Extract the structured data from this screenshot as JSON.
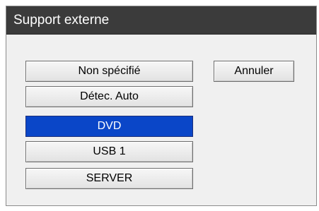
{
  "dialog": {
    "title": "Support externe"
  },
  "media_options": [
    {
      "label": "Non spécifié",
      "selected": false
    },
    {
      "label": "Détec. Auto",
      "selected": false
    },
    {
      "label": "DVD",
      "selected": true
    },
    {
      "label": "USB 1",
      "selected": false
    },
    {
      "label": "SERVER",
      "selected": false
    }
  ],
  "actions": {
    "cancel_label": "Annuler"
  },
  "colors": {
    "titlebar": "#3b3b3b",
    "selected": "#0a46c8",
    "panel": "#f0f0f0"
  }
}
